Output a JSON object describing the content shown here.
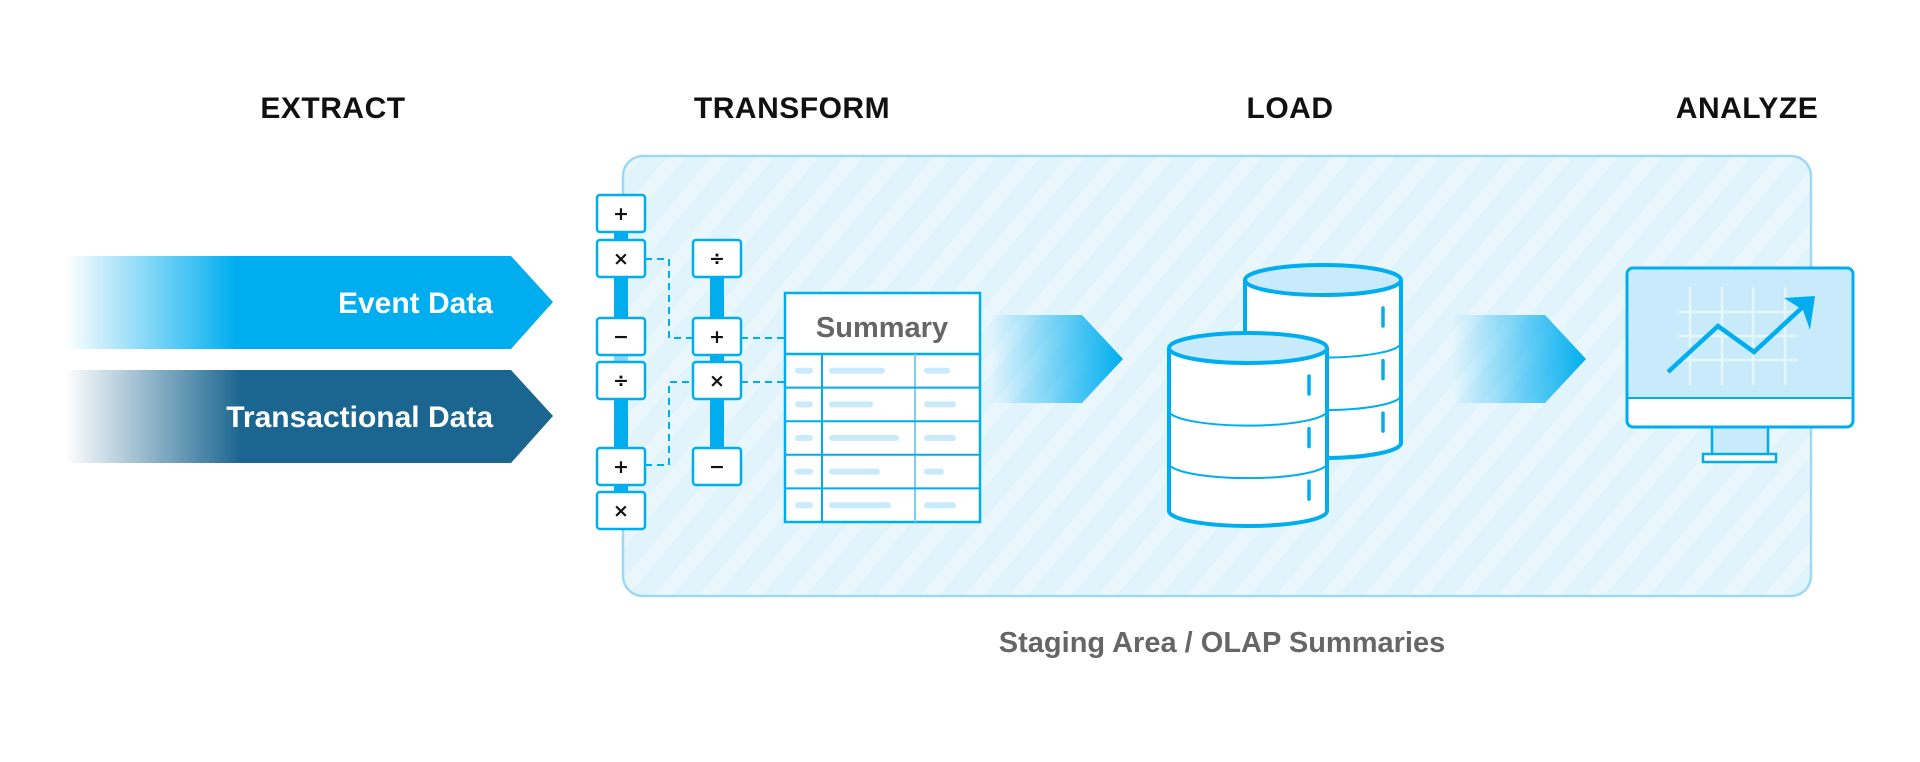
{
  "stages": {
    "extract": "EXTRACT",
    "transform": "TRANSFORM",
    "load": "LOAD",
    "analyze": "ANALYZE"
  },
  "sources": [
    {
      "label": "Event Data",
      "color": "#00AEEF"
    },
    {
      "label": "Transactional Data",
      "color": "#1B6690"
    }
  ],
  "operators": {
    "column1": [
      "+",
      "×",
      "−",
      "÷",
      "+",
      "×"
    ],
    "column2": [
      "÷",
      "+",
      "×",
      "−"
    ]
  },
  "summary_table": {
    "title": "Summary",
    "row_count": 5
  },
  "databases": {
    "count": 2
  },
  "analyze_icon": "monitor-chart-icon",
  "caption": "Staging Area / OLAP Summaries",
  "colors": {
    "accent": "#00AEEF",
    "dark_accent": "#1B6690",
    "staging_fill": "#E1F4FC",
    "staging_border": "#9ED8F5",
    "light_fill": "#C8EAFB",
    "placeholder_bar": "#C8EAFB"
  }
}
